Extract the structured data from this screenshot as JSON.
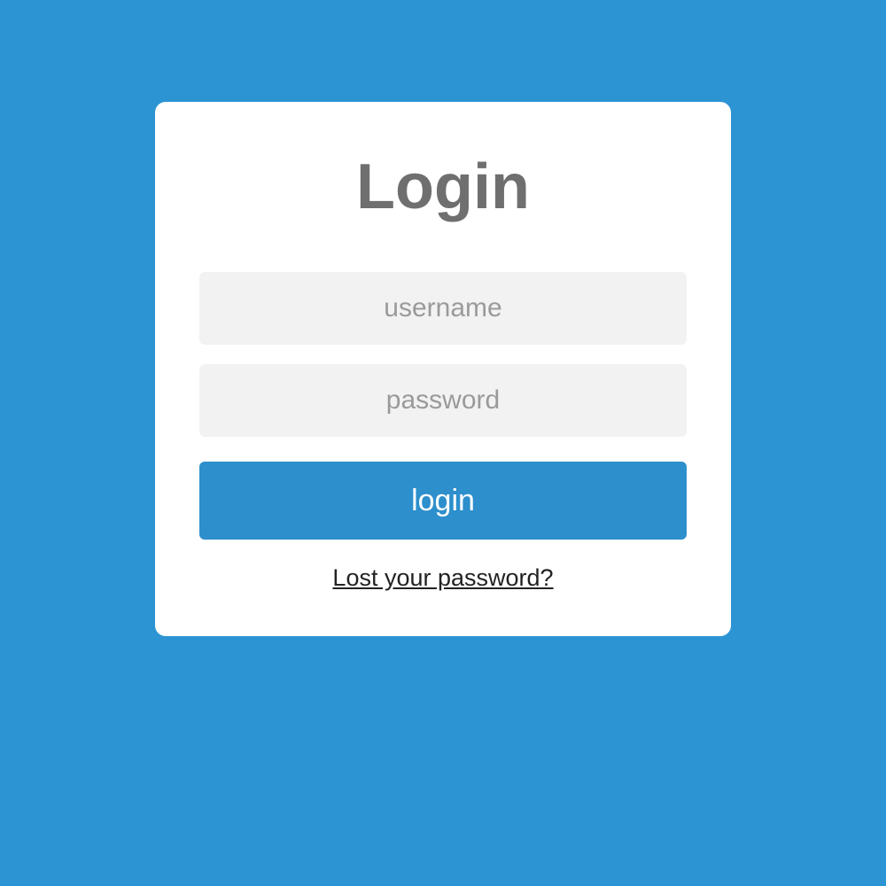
{
  "login": {
    "title": "Login",
    "username_placeholder": "username",
    "password_placeholder": "password",
    "button_label": "login",
    "lost_password_label": "Lost your password?"
  }
}
